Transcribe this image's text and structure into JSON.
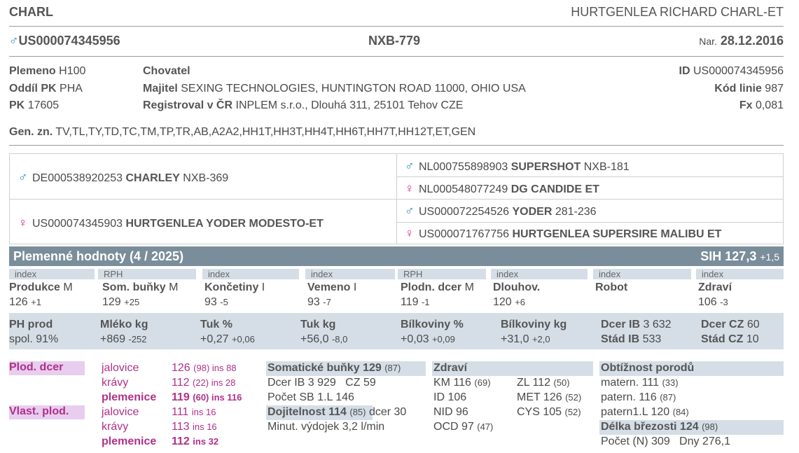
{
  "header": {
    "short_name": "CHARL",
    "full_name": "HURTGENLEA RICHARD CHARL-ET",
    "id": "US000074345956",
    "code": "NXB-779",
    "birth_label": "Nar.",
    "birth_date": "28.12.2016"
  },
  "info": {
    "plemeno_label": "Plemeno",
    "plemeno": "H100",
    "oddil_label": "Oddíl PK",
    "oddil": "PHA",
    "pk_label": "PK",
    "pk": "17605",
    "chovatel_label": "Chovatel",
    "majitel_label": "Majitel",
    "majitel": "SEXING TECHNOLOGIES, HUNTINGTON ROAD 11000, OHIO USA",
    "registroval_label": "Registroval v ČR",
    "registroval": "INPLEM s.r.o., Dlouhá 311, 25101 Tehov CZE",
    "id_label": "ID",
    "id": "US000074345956",
    "kod_linie_label": "Kód linie",
    "kod_linie": "987",
    "fx_label": "Fx",
    "fx": "0,081",
    "gen_label": "Gen. zn.",
    "gen": "TV,TL,TY,TD,TC,TM,TP,TR,AB,A2A2,HH1T,HH3T,HH4T,HH6T,HH7T,HH12T,ET,GEN"
  },
  "pedigree": {
    "sire": {
      "sex": "♂",
      "id": "DE000538920253",
      "name": "CHARLEY",
      "code": "NXB-369"
    },
    "dam": {
      "sex": "♀",
      "id": "US000074345903",
      "name": "HURTGENLEA YODER MODESTO-ET",
      "code": ""
    },
    "sire_sire": {
      "sex": "♂",
      "id": "NL000755898903",
      "name": "SUPERSHOT",
      "code": "NXB-181"
    },
    "sire_dam": {
      "sex": "♀",
      "id": "NL000548077249",
      "name": "DG CANDIDE ET",
      "code": ""
    },
    "dam_sire": {
      "sex": "♂",
      "id": "US000072254526",
      "name": "YODER",
      "code": "281-236"
    },
    "dam_dam": {
      "sex": "♀",
      "id": "US000071767756",
      "name": "HURTGENLEA SUPERSIRE MALIBU ET",
      "code": ""
    }
  },
  "bv": {
    "title": "Plemenné hodnoty (4 / 2025)",
    "sih_label": "SIH 127,3",
    "sih_delta": "+1,5",
    "traits": [
      {
        "cat": "index",
        "name": "Produkce",
        "suffix": "M",
        "value": "126",
        "delta": "+1"
      },
      {
        "cat": "RPH",
        "name": "Som. buňky",
        "suffix": "M",
        "value": "129",
        "delta": "+25"
      },
      {
        "cat": "index",
        "name": "Končetiny",
        "suffix": "I",
        "value": "93",
        "delta": "-5"
      },
      {
        "cat": "index",
        "name": "Vemeno",
        "suffix": "I",
        "value": "93",
        "delta": "-7"
      },
      {
        "cat": "RPH",
        "name": "Plodn. dcer",
        "suffix": "M",
        "value": "119",
        "delta": "-1"
      },
      {
        "cat": "index",
        "name": "Dlouhov.",
        "suffix": "",
        "value": "120",
        "delta": "+6"
      },
      {
        "cat": "index",
        "name": "Robot",
        "suffix": "",
        "value": "",
        "delta": ""
      },
      {
        "cat": "index",
        "name": "Zdraví",
        "suffix": "",
        "value": "106",
        "delta": "-3"
      }
    ],
    "prod": [
      {
        "name": "PH prod",
        "value": "spol. 91%",
        "delta": ""
      },
      {
        "name": "Mléko kg",
        "value": "+869",
        "delta": "-252"
      },
      {
        "name": "Tuk %",
        "value": "+0,27",
        "delta": "+0,06"
      },
      {
        "name": "Tuk kg",
        "value": "+56,0",
        "delta": "-8,0"
      },
      {
        "name": "Bílkoviny %",
        "value": "+0,03",
        "delta": "+0,09"
      },
      {
        "name": "Bílkoviny kg",
        "value": "+31,0",
        "delta": "+2,0"
      }
    ],
    "dcer_ib_label": "Dcer IB",
    "dcer_ib": "3 632",
    "stad_ib_label": "Stád IB",
    "stad_ib": "533",
    "dcer_cz_label": "Dcer CZ",
    "dcer_cz": "60",
    "stad_cz_label": "Stád CZ",
    "stad_cz": "10"
  },
  "fertility": {
    "plod_dcer": "Plod. dcer",
    "vlast_plod": "Vlast. plod.",
    "rows_dcer": [
      {
        "label": "jalovice",
        "value": "126",
        "extra": "(98) ins 88",
        "bold": false
      },
      {
        "label": "krávy",
        "value": "112",
        "extra": "(22) ins 28",
        "bold": false
      },
      {
        "label": "plemenice",
        "value": "119",
        "extra": "(60) ins 116",
        "bold": true
      }
    ],
    "rows_vlast": [
      {
        "label": "jalovice",
        "value": "111",
        "extra": "ins 16",
        "bold": false
      },
      {
        "label": "krávy",
        "value": "113",
        "extra": "ins 16",
        "bold": false
      },
      {
        "label": "plemenice",
        "value": "112",
        "extra": "ins 32",
        "bold": true
      }
    ]
  },
  "somatic": {
    "title": "Somatické buňky 129",
    "title_n": "(87)",
    "line1": "Dcer IB 3 929",
    "line1b": "CZ 59",
    "line2": "Počet SB 1.L 146",
    "milk_title": "Dojitelnost 114",
    "milk_n": "(85)",
    "milk_extra": "dcer 30",
    "line4": "Minut. výdojek 3,2 l/min"
  },
  "health": {
    "title": "Zdraví",
    "left": [
      {
        "name": "KM 116",
        "n": "(69)"
      },
      {
        "name": "ID 106",
        "n": ""
      },
      {
        "name": "NID 96",
        "n": ""
      },
      {
        "name": "OCD 97",
        "n": "(47)"
      }
    ],
    "right": [
      {
        "name": "ZL 112",
        "n": "(50)"
      },
      {
        "name": "MET 126",
        "n": "(52)"
      },
      {
        "name": "CYS 105",
        "n": "(52)"
      }
    ]
  },
  "calving": {
    "title": "Obtížnost porodů",
    "rows": [
      {
        "name": "matern. 111",
        "n": "(33)"
      },
      {
        "name": "patern. 116",
        "n": "(87)"
      },
      {
        "name": "patern1.L 120",
        "n": "(84)"
      }
    ],
    "gest_title": "Délka březosti 124",
    "gest_n": "(98)",
    "gest_line": "Počet (N) 309   Dny 276,1"
  }
}
